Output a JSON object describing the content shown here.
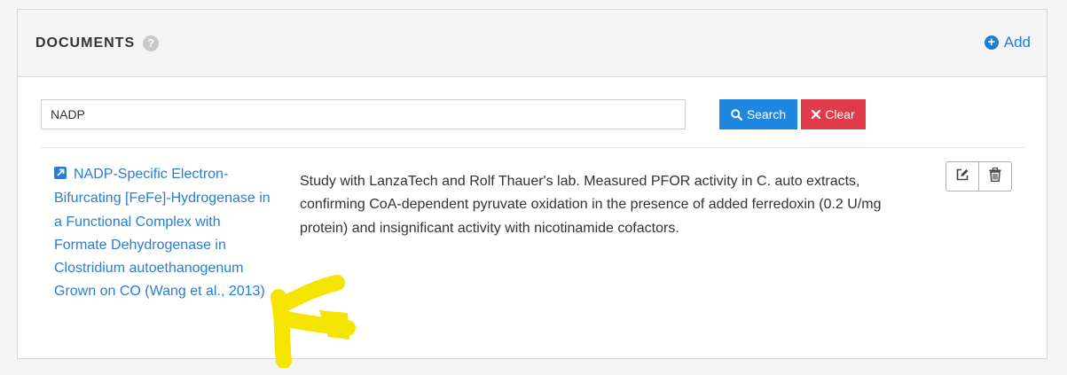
{
  "panel": {
    "title": "DOCUMENTS",
    "help_icon": "question-circle-icon",
    "help_glyph": "?",
    "add_label": "Add",
    "add_icon": "plus-circle-icon"
  },
  "search": {
    "value": "NADP",
    "search_label": "Search",
    "clear_label": "Clear"
  },
  "documents": [
    {
      "title": "NADP-Specific Electron-Bifurcating [FeFe]-Hydrogenase in a Functional Complex with Formate Dehydrogenase in Clostridium autoethanogenum Grown on CO (Wang et al., 2013)",
      "description": "Study with LanzaTech and Rolf Thauer's lab. Measured PFOR activity in C. auto extracts, confirming CoA-dependent pyruvate oxidation in the presence of added ferredoxin (0.2 U/mg protein) and insignificant activity with nicotinamide cofactors.",
      "link_icon": "external-link-icon",
      "actions": [
        "edit-icon",
        "trash-icon"
      ]
    }
  ],
  "colors": {
    "link": "#2a7dd1",
    "search_button": "#1f87e0",
    "clear_button": "#df3b4a",
    "highlight": "#f5e400"
  }
}
